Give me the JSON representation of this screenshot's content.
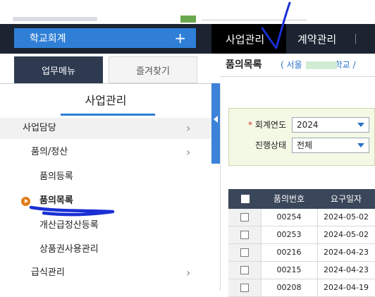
{
  "header": {
    "org_button_label": "학교회계",
    "org_button_plus": "+",
    "tabs": [
      {
        "label": "사업관리",
        "active": true
      },
      {
        "label": "계약관리",
        "active": false
      }
    ]
  },
  "sidebar": {
    "tabs": [
      "업무메뉴",
      "즐겨찾기"
    ],
    "section_title": "사업관리",
    "items": [
      {
        "label": "사업담당",
        "chevron": "›"
      },
      {
        "label": "품의/정산",
        "chevron": "›"
      },
      {
        "label": "품의등록"
      },
      {
        "label": "품의목록",
        "selected": true
      },
      {
        "label": "개산급정산등록"
      },
      {
        "label": "상품권사용관리"
      },
      {
        "label": "급식관리",
        "chevron": "›"
      }
    ]
  },
  "content": {
    "page_title": "품의목록",
    "breadcrumb": "( 서울",
    "breadcrumb_tail": "학교 /",
    "filters": [
      {
        "label": "회계연도",
        "required": true,
        "value": "2024"
      },
      {
        "label": "진행상태",
        "required": false,
        "value": "전체"
      }
    ],
    "table": {
      "columns": [
        "품의번호",
        "요구일자"
      ],
      "rows": [
        {
          "no": "00254",
          "date": "2024-05-02"
        },
        {
          "no": "00253",
          "date": "2024-05-02"
        },
        {
          "no": "00216",
          "date": "2024-04-23"
        },
        {
          "no": "00215",
          "date": "2024-04-23"
        },
        {
          "no": "00208",
          "date": "2024-04-19"
        }
      ]
    }
  },
  "colors": {
    "header_bg": "#1c2432",
    "accent_blue": "#2f7fd6",
    "bullet_orange": "#e07b1a",
    "annotation_blue": "#1a2fd4"
  },
  "icons": [
    "plus-icon",
    "chevron-right-icon",
    "collapse-arrow-icon",
    "dropdown-arrow-icon",
    "play-bullet-icon"
  ]
}
